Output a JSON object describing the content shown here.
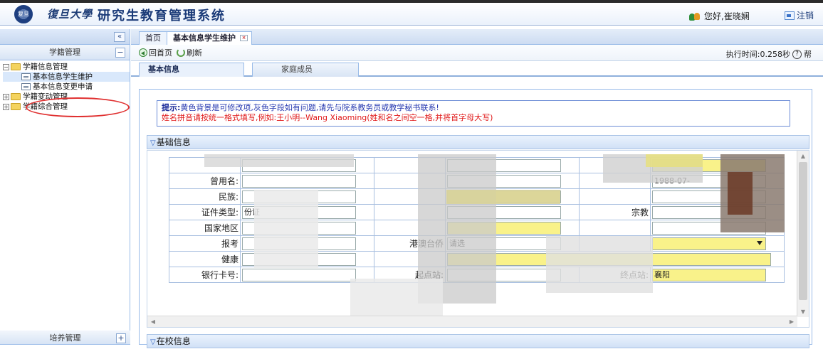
{
  "header": {
    "logo_text": "复旦",
    "university": "復旦大學",
    "system_title": "研究生教育管理系统",
    "user_greeting": "您好,崔晓娴",
    "logout_label": "注销"
  },
  "sidebar": {
    "collapse_symbol": "«",
    "section_title": "学籍管理",
    "section_toggle": "−",
    "tree": [
      {
        "label": "学籍信息管理",
        "expanded": true,
        "children": [
          {
            "label": "基本信息学生维护",
            "selected": true
          },
          {
            "label": "基本信息变更申请"
          }
        ]
      },
      {
        "label": "学籍变动管理",
        "expanded": false
      },
      {
        "label": "学籍综合管理",
        "expanded": false
      }
    ],
    "bottom_section_title": "培养管理",
    "bottom_section_toggle": "+"
  },
  "tabs": {
    "home": "首页",
    "active": "基本信息学生维护",
    "close_symbol": "×"
  },
  "toolbar": {
    "back_home": "回首页",
    "refresh": "刷新",
    "exec_time": "执行时间:0.258秒",
    "help_symbol": "?",
    "help_tail": "帮"
  },
  "subtabs": {
    "basic": "基本信息",
    "family": "家庭成员"
  },
  "tip": {
    "label": "提示:",
    "line1": "黄色背景是可修改项,灰色字段如有问题,请先与院系教务员或教学秘书联系!",
    "line2": "姓名拼音请按统一格式填写,例如:王小明--Wang Xiaoming(姓和名之间空一格,并将首字母大写)"
  },
  "sections": {
    "basic": "基础信息",
    "school": "在校信息"
  },
  "form": {
    "labels": {
      "former_name": "曾用名:",
      "ethnicity": "民族:",
      "id_type": "证件类型:",
      "country": "国家地区",
      "exam_type": "报考",
      "health": "健康",
      "bank_card": "银行卡号:",
      "start_station": "起点站:",
      "end_station": "终点站:",
      "hk_mo_tw": "港澳台侨",
      "religion": "宗教"
    },
    "values": {
      "birth_date_partial": "1988-07-",
      "id_type_partial": "份证",
      "end_station": "襄阳",
      "hk_mo_tw_partial": "请选"
    }
  },
  "colors": {
    "header_title": "#1a3a78",
    "tip_blue": "#2538b0",
    "tip_red": "#e01818",
    "editable_yellow": "#f9f28a",
    "border_blue": "#99bbe8"
  }
}
